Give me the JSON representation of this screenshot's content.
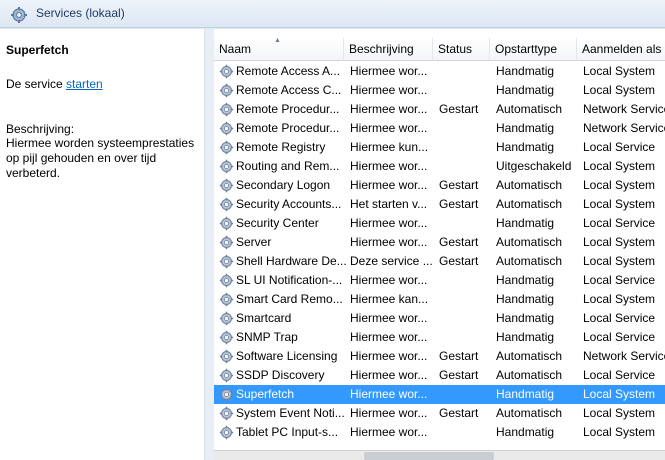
{
  "window": {
    "title": "Services (lokaal)"
  },
  "detail": {
    "service_name": "Superfetch",
    "action_prefix": "De service ",
    "action_link": "starten",
    "description_label": "Beschrijving:",
    "description_text": "Hiermee worden systeemprestaties op pijl gehouden en over tijd verbeterd."
  },
  "columns": {
    "name": "Naam",
    "description": "Beschrijving",
    "status": "Status",
    "startup": "Opstarttype",
    "logon": "Aanmelden als"
  },
  "services": [
    {
      "name": "Remote Access A...",
      "description": "Hiermee wor...",
      "status": "",
      "startup": "Handmatig",
      "logon": "Local System"
    },
    {
      "name": "Remote Access C...",
      "description": "Hiermee wor...",
      "status": "",
      "startup": "Handmatig",
      "logon": "Local System"
    },
    {
      "name": "Remote Procedur...",
      "description": "Hiermee wor...",
      "status": "Gestart",
      "startup": "Automatisch",
      "logon": "Network Service"
    },
    {
      "name": "Remote Procedur...",
      "description": "Hiermee wor...",
      "status": "",
      "startup": "Handmatig",
      "logon": "Network Service"
    },
    {
      "name": "Remote Registry",
      "description": "Hiermee kun...",
      "status": "",
      "startup": "Handmatig",
      "logon": "Local Service"
    },
    {
      "name": "Routing and Rem...",
      "description": "Hiermee wor...",
      "status": "",
      "startup": "Uitgeschakeld",
      "logon": "Local System"
    },
    {
      "name": "Secondary Logon",
      "description": "Hiermee wor...",
      "status": "Gestart",
      "startup": "Automatisch",
      "logon": "Local System"
    },
    {
      "name": "Security Accounts...",
      "description": "Het starten v...",
      "status": "Gestart",
      "startup": "Automatisch",
      "logon": "Local System"
    },
    {
      "name": "Security Center",
      "description": "Hiermee wor...",
      "status": "",
      "startup": "Handmatig",
      "logon": "Local Service"
    },
    {
      "name": "Server",
      "description": "Hiermee wor...",
      "status": "Gestart",
      "startup": "Automatisch",
      "logon": "Local System"
    },
    {
      "name": "Shell Hardware De...",
      "description": "Deze service ...",
      "status": "Gestart",
      "startup": "Automatisch",
      "logon": "Local System"
    },
    {
      "name": "SL UI Notification-...",
      "description": "Hiermee wor...",
      "status": "",
      "startup": "Handmatig",
      "logon": "Local Service"
    },
    {
      "name": "Smart Card Remo...",
      "description": "Hiermee kan...",
      "status": "",
      "startup": "Handmatig",
      "logon": "Local System"
    },
    {
      "name": "Smartcard",
      "description": "Hiermee wor...",
      "status": "",
      "startup": "Handmatig",
      "logon": "Local Service"
    },
    {
      "name": "SNMP Trap",
      "description": "Hiermee wor...",
      "status": "",
      "startup": "Handmatig",
      "logon": "Local Service"
    },
    {
      "name": "Software Licensing",
      "description": "Hiermee wor...",
      "status": "Gestart",
      "startup": "Automatisch",
      "logon": "Network Service"
    },
    {
      "name": "SSDP Discovery",
      "description": "Hiermee wor...",
      "status": "Gestart",
      "startup": "Automatisch",
      "logon": "Local Service"
    },
    {
      "name": "Superfetch",
      "description": "Hiermee wor...",
      "status": "",
      "startup": "Handmatig",
      "logon": "Local System",
      "selected": true
    },
    {
      "name": "System Event Noti...",
      "description": "Hiermee wor...",
      "status": "Gestart",
      "startup": "Automatisch",
      "logon": "Local System"
    },
    {
      "name": "Tablet PC Input-s...",
      "description": "Hiermee wor...",
      "status": "",
      "startup": "Handmatig",
      "logon": "Local System"
    }
  ],
  "colors": {
    "selection": "#3399ff",
    "link": "#0066cc",
    "title_text": "#1e395b"
  }
}
